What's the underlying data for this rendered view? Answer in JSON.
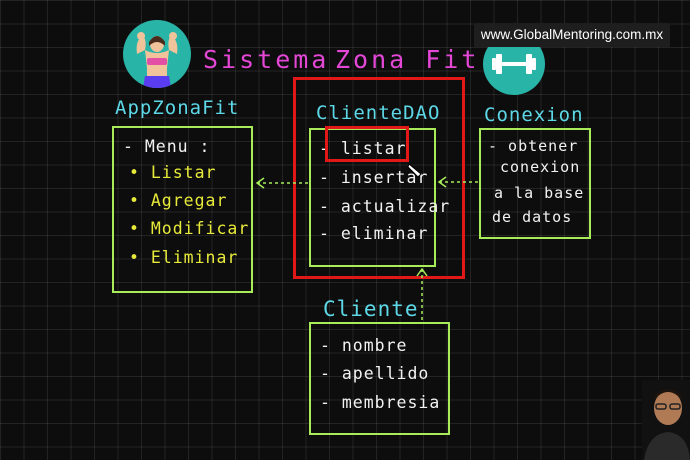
{
  "header": {
    "website": "www.GlobalMentoring.com.mx",
    "title_word1": "Sistema",
    "title_word2": "Zona Fit"
  },
  "app_box": {
    "title": "AppZonaFit",
    "menu_label": "- Menu :",
    "options": [
      "Listar",
      "Agregar",
      "Modificar",
      "Eliminar"
    ]
  },
  "dao_box": {
    "title": "ClienteDAO",
    "methods": [
      "- listar",
      "- insertar",
      "- actualizar",
      "- eliminar"
    ]
  },
  "conexion_box": {
    "title": "Conexion",
    "lines": [
      "- obtener",
      "conexion",
      "a la base",
      "de datos"
    ]
  },
  "cliente_box": {
    "title": "Cliente",
    "fields": [
      "- nombre",
      "- apellido",
      "- membresia"
    ]
  },
  "colors": {
    "box_border": "#a8ec5a",
    "heading": "#5dd8e6",
    "menu_option": "#e8ea3a",
    "highlight": "#e01818",
    "title": "#e447d6",
    "icon_bg": "#29b4a8"
  }
}
